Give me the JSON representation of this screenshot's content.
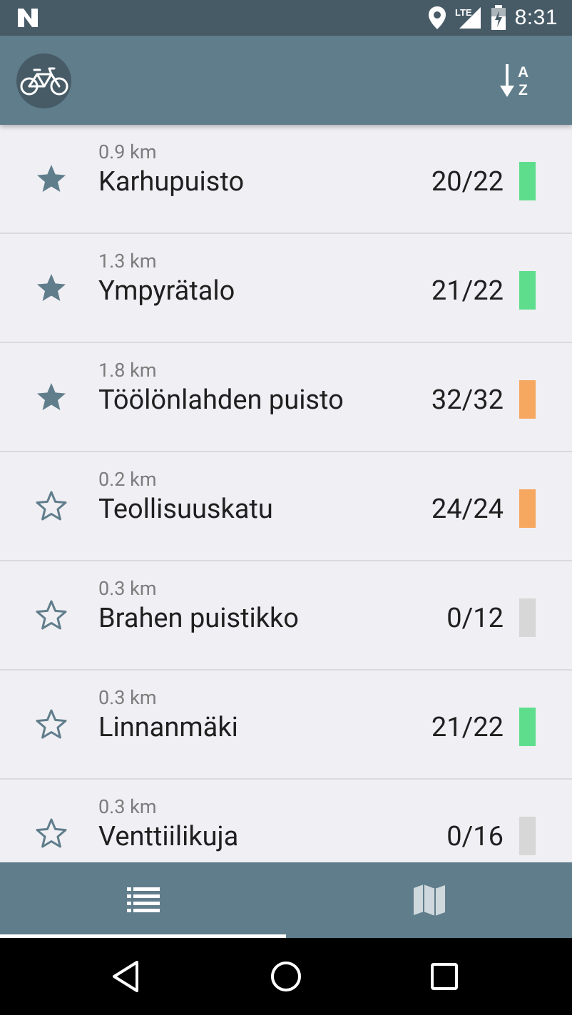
{
  "status_bar": {
    "time": "8:31",
    "network": "LTE",
    "icons": [
      "n-notification-icon",
      "location-icon",
      "signal-icon",
      "battery-icon"
    ]
  },
  "app_bar": {
    "logo_icon": "bicycle-icon",
    "sort_icon": "sort-alpha-icon",
    "sort_letters": [
      "A",
      "Z"
    ]
  },
  "stations": [
    {
      "distance": "0.9 km",
      "name": "Karhupuisto",
      "count": "20/22",
      "favorite": true,
      "status_color": "#5ede8c"
    },
    {
      "distance": "1.3 km",
      "name": "Ympyrätalo",
      "count": "21/22",
      "favorite": true,
      "status_color": "#5ede8c"
    },
    {
      "distance": "1.8 km",
      "name": "Töölönlahden puisto",
      "count": "32/32",
      "favorite": true,
      "status_color": "#f6a861"
    },
    {
      "distance": "0.2 km",
      "name": "Teollisuuskatu",
      "count": "24/24",
      "favorite": false,
      "status_color": "#f6a861"
    },
    {
      "distance": "0.3 km",
      "name": "Brahen puistikko",
      "count": "0/12",
      "favorite": false,
      "status_color": "#d7d7d7"
    },
    {
      "distance": "0.3 km",
      "name": "Linnanmäki",
      "count": "21/22",
      "favorite": false,
      "status_color": "#5ede8c"
    },
    {
      "distance": "0.3 km",
      "name": "Venttiilikuja",
      "count": "0/16",
      "favorite": false,
      "status_color": "#d7d7d7"
    }
  ],
  "tabs": [
    {
      "icon": "list-icon",
      "selected": true
    },
    {
      "icon": "map-icon",
      "selected": false
    }
  ],
  "nav_bar": {
    "icons": [
      "back-icon",
      "home-icon",
      "recents-icon"
    ]
  },
  "colors": {
    "primary": "#607d8b",
    "primary_dark": "#475b67",
    "star": "#607d8b",
    "background": "#efeff4"
  }
}
